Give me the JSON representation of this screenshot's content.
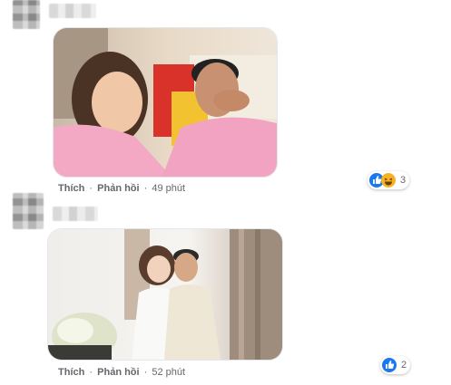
{
  "comments": [
    {
      "like_label": "Thích",
      "reply_label": "Phản hồi",
      "dot": "·",
      "time": "49 phút",
      "reactions": {
        "types": [
          "like-icon",
          "haha-icon"
        ],
        "count": "3"
      }
    },
    {
      "like_label": "Thích",
      "reply_label": "Phản hồi",
      "dot": "·",
      "time": "52 phút",
      "reactions": {
        "types": [
          "like-icon"
        ],
        "count": "2"
      }
    }
  ],
  "colors": {
    "like_blue": "#1877f2",
    "haha_yellow": "#f7b125",
    "meta_text": "#65676b"
  }
}
